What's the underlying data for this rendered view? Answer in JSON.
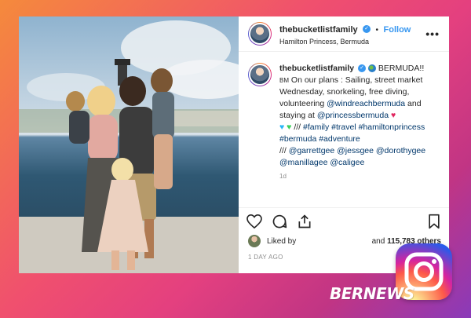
{
  "post": {
    "username": "thebucketlistfamily",
    "follow_label": "Follow",
    "location": "Hamilton Princess, Bermuda",
    "more_label": "•••",
    "caption": {
      "username": "thebucketlistfamily",
      "line_title": "BERMUDA!!",
      "line1": "On our plans : Sailing, street market Wednesday, snorkeling, free diving, volunteering",
      "mention_wind": "@windreachbermuda",
      "line_stay": "and staying at",
      "mention_princess": "@princessbermuda",
      "hashtags_sep": "///",
      "hashtags": "#family #travel #hamiltonprincess #bermuda #adventure",
      "credits_sep": "///",
      "credits": "@garrettgee @jessgee @dorothygee @manillagee @caligee",
      "partial_time": "1d",
      "bm_prefix": "BM"
    },
    "liked_by_label": "Liked by",
    "liked_and": "and",
    "likes_count": "115,783 others",
    "timestamp": "1 DAY AGO"
  },
  "icons": [
    "heart-icon",
    "comment-icon",
    "share-icon",
    "bookmark-icon",
    "verified-icon",
    "globe-icon",
    "instagram-logo-icon"
  ],
  "watermark": "BERNEWS"
}
